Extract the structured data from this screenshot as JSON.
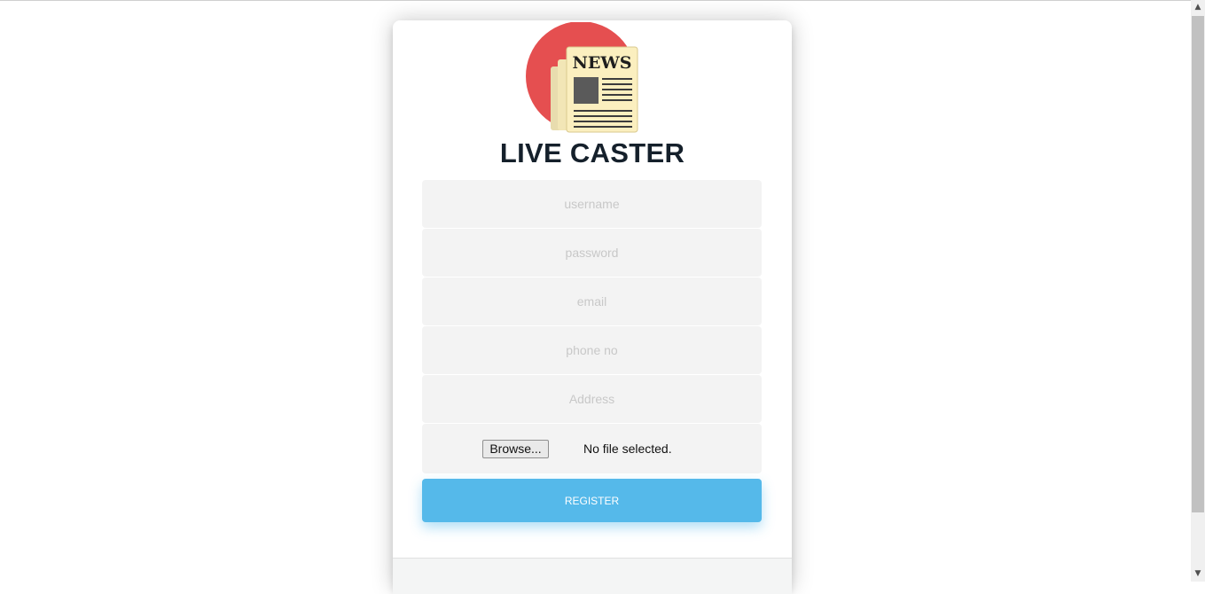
{
  "app": {
    "title": "LIVE CASTER",
    "logo_text": "NEWS"
  },
  "form": {
    "username_placeholder": "username",
    "password_placeholder": "password",
    "email_placeholder": "email",
    "phone_placeholder": "phone no",
    "address_placeholder": "Address",
    "browse_label": "Browse...",
    "file_status": "No file selected.",
    "register_label": "REGISTER"
  },
  "colors": {
    "accent": "#55b9ea",
    "logo_circle": "#e54f50",
    "title": "#15202b"
  },
  "icons": {
    "logo": "newspaper-icon"
  }
}
